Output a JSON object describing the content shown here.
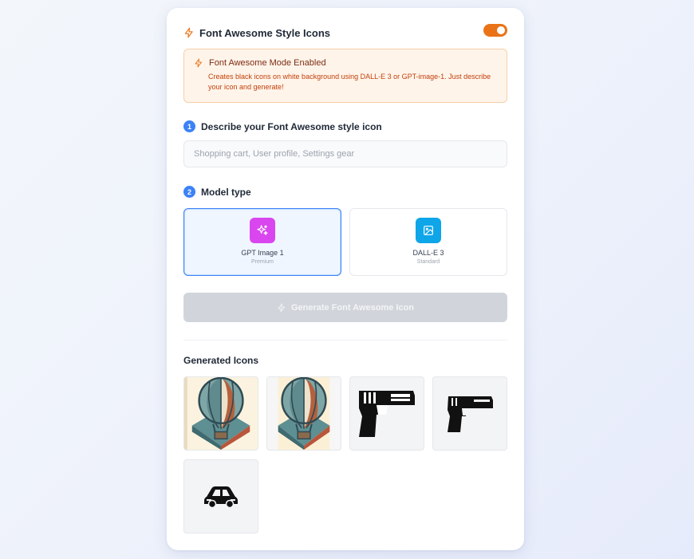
{
  "header": {
    "title": "Font Awesome Style Icons",
    "icon": "bolt-icon",
    "toggle_on": true
  },
  "notice": {
    "title": "Font Awesome Mode Enabled",
    "description": "Creates black icons on white background using DALL-E 3 or GPT-image-1. Just describe your icon and generate!",
    "icon": "bolt-icon"
  },
  "step1": {
    "number": "1",
    "label": "Describe your Font Awesome style icon"
  },
  "input": {
    "placeholder": "Shopping cart, User profile, Settings gear",
    "value": ""
  },
  "step2": {
    "number": "2",
    "label": "Model type"
  },
  "models": [
    {
      "name": "GPT Image 1",
      "tier": "Premium",
      "icon": "sparkles-icon",
      "color": "#d946ef",
      "selected": true
    },
    {
      "name": "DALL-E 3",
      "tier": "Standard",
      "icon": "image-icon",
      "color": "#0ea5e9",
      "selected": false
    }
  ],
  "generate_button": {
    "label": "Generate Font Awesome Icon",
    "disabled": true
  },
  "generated": {
    "title": "Generated Icons",
    "items": [
      {
        "icon": "hot-air-balloon-icon"
      },
      {
        "icon": "hot-air-balloon-icon"
      },
      {
        "icon": "pistol-icon"
      },
      {
        "icon": "pistol-icon"
      },
      {
        "icon": "car-icon"
      }
    ]
  },
  "colors": {
    "accent": "#3b82f6",
    "toggle": "#ea7317",
    "notice_bg": "#fff4ea"
  }
}
